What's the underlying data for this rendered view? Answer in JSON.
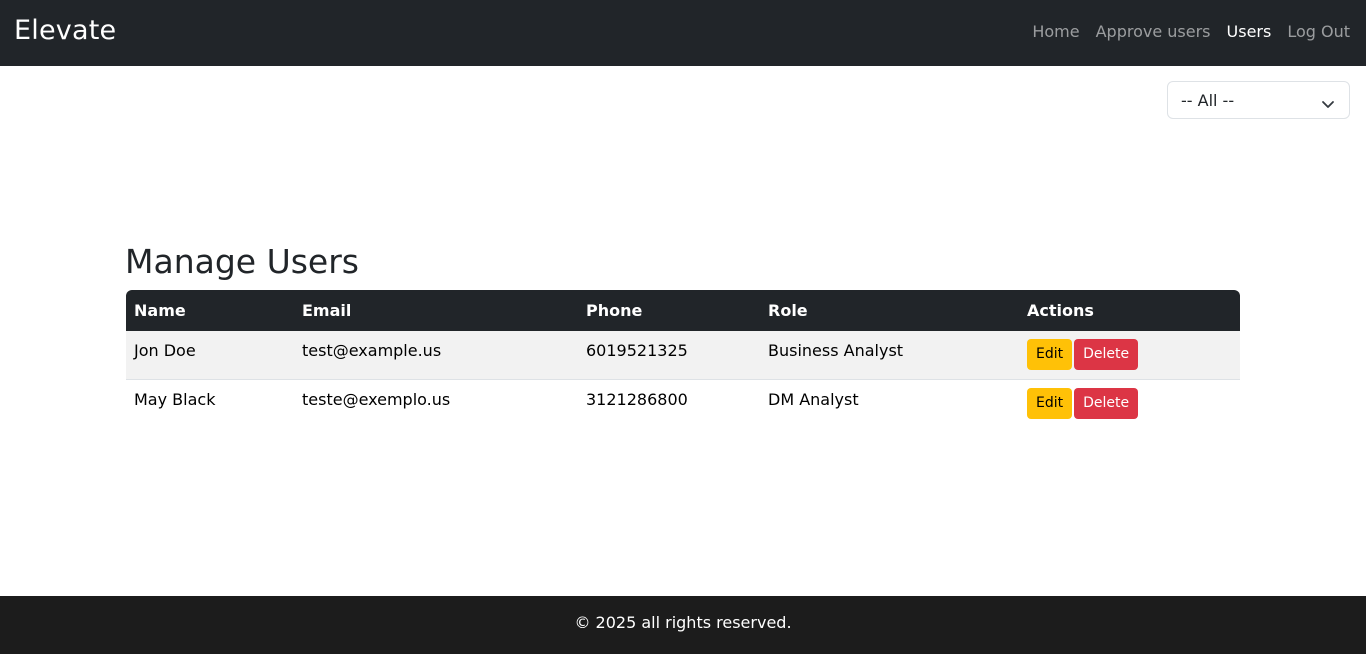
{
  "brand": "Elevate",
  "nav": {
    "home": "Home",
    "approve_users": "Approve users",
    "users": "Users",
    "logout": "Log Out"
  },
  "filter": {
    "selected": "-- All --"
  },
  "page_title": "Manage Users",
  "table": {
    "headers": [
      "Name",
      "Email",
      "Phone",
      "Role",
      "Actions"
    ],
    "rows": [
      {
        "name": "Jon Doe",
        "email": "test@example.us",
        "phone": "6019521325",
        "role": "Business Analyst",
        "edit": "Edit",
        "delete": "Delete"
      },
      {
        "name": "May Black",
        "email": "teste@exemplo.us",
        "phone": "3121286800",
        "role": "DM Analyst",
        "edit": "Edit",
        "delete": "Delete"
      }
    ]
  },
  "footer": {
    "text": "© 2025 all rights reserved."
  },
  "colors": {
    "navbar_bg": "#212529",
    "edit_button": "#ffc107",
    "delete_button": "#dc3545",
    "footer_bg": "#1c1c1c"
  }
}
